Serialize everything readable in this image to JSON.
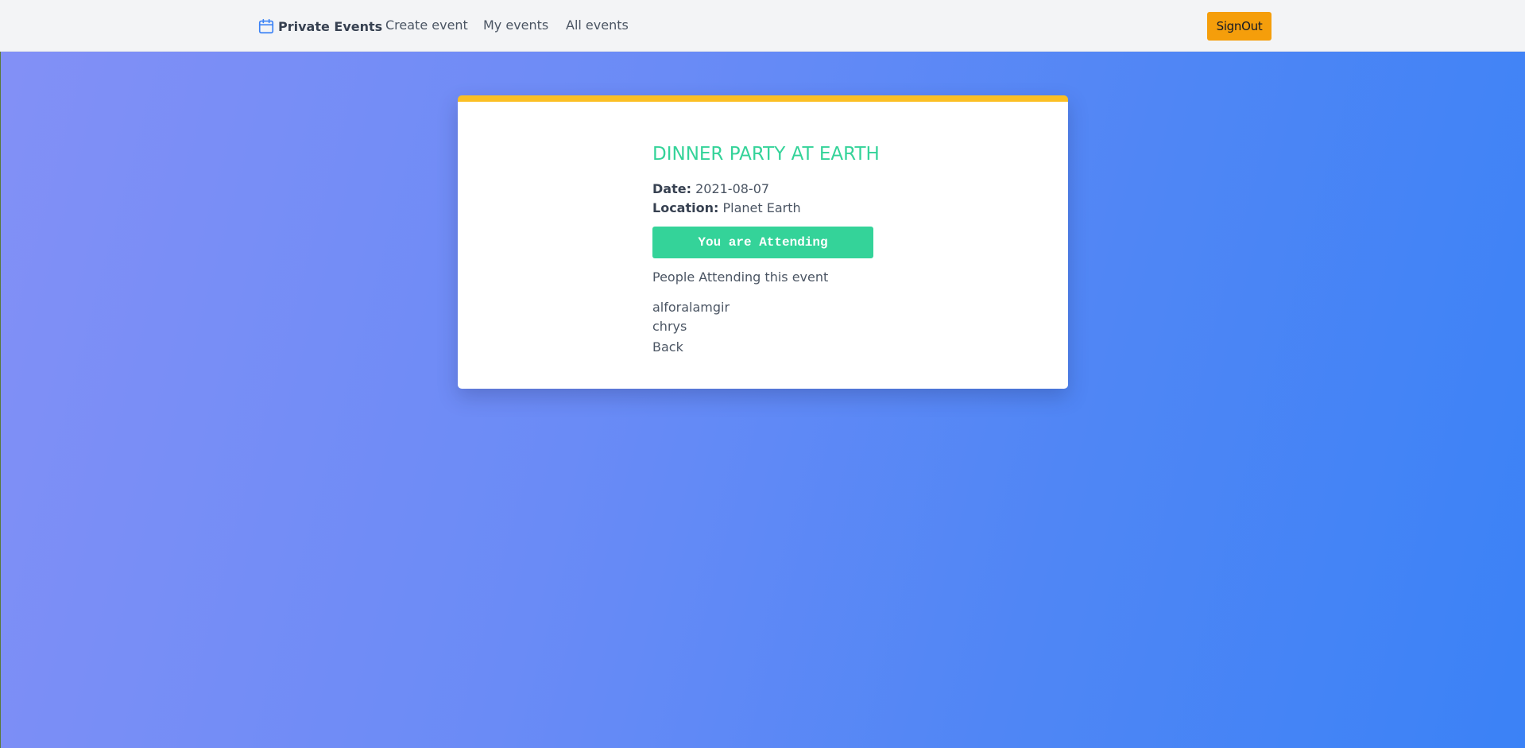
{
  "navbar": {
    "brand": "Private Events",
    "brand_icon": "calendar-icon",
    "links": {
      "create": "Create event",
      "my": "My events",
      "all": "All events"
    },
    "signout_label": "SignOut"
  },
  "event": {
    "title": "DINNER PARTY AT EARTH",
    "date_label": "Date:",
    "date": "2021-08-07",
    "location_label": "Location:",
    "location": "Planet Earth",
    "attend_button": "You are Attending",
    "attendees_heading": "People Attending this event",
    "attendees": [
      "alforalamgir",
      "chrys"
    ],
    "back_label": "Back"
  },
  "colors": {
    "accent_green": "#34d399",
    "signout_orange": "#f59e0b",
    "card_top_border": "#fbbf24",
    "brand_icon": "#3b82f6"
  }
}
